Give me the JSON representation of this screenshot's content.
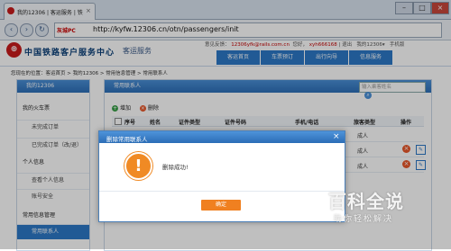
{
  "browser": {
    "tab_title": "我的12306 | 客运服务 | 铁",
    "url_label": "灰城PC",
    "url": "http://kyfw.12306.cn/otn/passengers/init"
  },
  "site": {
    "name": "中国铁路客户服务中心",
    "sub": "客运服务",
    "top_links": {
      "welcome": "意见反馈：",
      "email": "12306yfk@rails.com.cn",
      "hello": "您好，",
      "user": "xyh666168",
      "sep": "|",
      "logout": "退出",
      "my": "我的12306",
      "mobile": "手机版"
    },
    "nav": [
      "客运首页",
      "车票预订",
      "出行向导",
      "信息服务"
    ]
  },
  "breadcrumb": "您现在的位置：客运首页 > 我的12306 > 常用信息管理 > 常用联系人",
  "sidebar": {
    "head": "我的12306",
    "items": [
      {
        "label": "我的火车票"
      },
      {
        "label": "未完成订单"
      },
      {
        "label": "已完成订单（改/退）"
      },
      {
        "label": "个人信息"
      },
      {
        "label": "查看个人信息"
      },
      {
        "label": "账号安全"
      },
      {
        "label": "常用信息管理"
      },
      {
        "label": "常用联系人"
      }
    ]
  },
  "panel": {
    "title": "常用联系人",
    "search_placeholder": "输入乘客姓名",
    "add": "增加",
    "delete": "删除",
    "columns": [
      "序号",
      "姓名",
      "证件类型",
      "证件号码",
      "手机/电话",
      "旅客类型",
      "操作"
    ],
    "rows": [
      {
        "type": "成人"
      },
      {
        "type": "成人"
      },
      {
        "type": "成人"
      }
    ]
  },
  "dialog": {
    "title": "删除常用联系人",
    "message": "删除成功!",
    "ok": "确定"
  },
  "watermark": {
    "title": "百科全说",
    "sub": "助你轻松解决"
  }
}
